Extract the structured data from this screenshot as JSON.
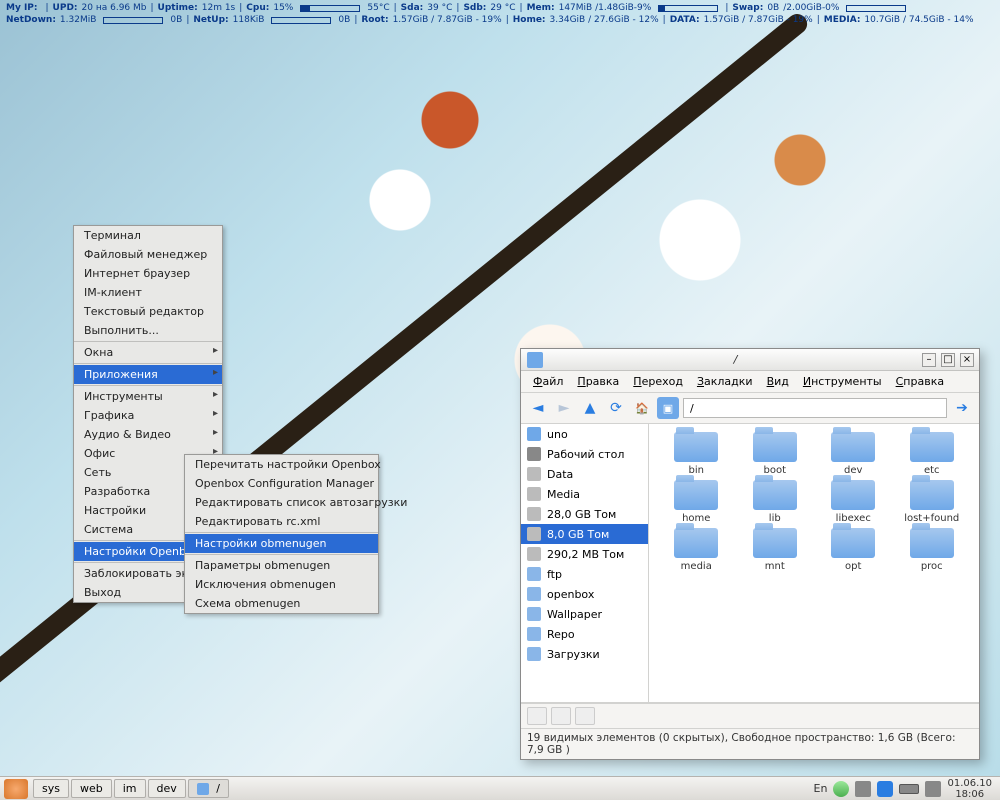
{
  "sysbar": {
    "line1": {
      "ip_label": "My IP:",
      "ip_value": "",
      "upd_label": "UPD:",
      "upd_value": "20 на 6.96 Mb",
      "uptime_label": "Uptime:",
      "uptime_value": "12m 1s",
      "cpu_label": "Cpu:",
      "cpu_value": "15%",
      "cpu_fill": 15,
      "temp1": "55°C",
      "sda_label": "Sda:",
      "sda_value": "39 °C",
      "sdb_label": "Sdb:",
      "sdb_value": "29 °C",
      "mem_label": "Mem:",
      "mem_value": "147MiB /1.48GiB-9%",
      "mem_fill": 9,
      "swap_label": "Swap:",
      "swap_value": "0B",
      "swap_disk": "/2.00GiB-0%",
      "swap_fill": 0
    },
    "line2": {
      "ndown_label": "NetDown:",
      "ndown_value": "1.32MiB",
      "ndown_rate": "0B",
      "nup_label": "NetUp:",
      "nup_value": "118KiB",
      "nup_rate": "0B",
      "root_label": "Root:",
      "root_value": "1.57GiB / 7.87GiB - 19%",
      "home_label": "Home:",
      "home_value": "3.34GiB / 27.6GiB - 12%",
      "data_label": "DATA:",
      "data_value": "1.57GiB / 7.87GiB - 19%",
      "media_label": "MEDIA:",
      "media_value": "10.7GiB / 74.5GiB - 14%"
    }
  },
  "rootmenu": {
    "items": [
      {
        "label": "Терминал"
      },
      {
        "label": "Файловый менеджер"
      },
      {
        "label": "Интернет браузер"
      },
      {
        "label": "IM-клиент"
      },
      {
        "label": "Текстовый редактор"
      },
      {
        "label": "Выполнить..."
      }
    ],
    "windows": {
      "label": "Окна",
      "arrow": true
    },
    "apps": {
      "label": "Приложения",
      "arrow": true,
      "hl": true
    },
    "cats": [
      {
        "label": "Инструменты",
        "arrow": true
      },
      {
        "label": "Графика",
        "arrow": true
      },
      {
        "label": "Аудио & Видео",
        "arrow": true
      },
      {
        "label": "Офис",
        "arrow": true
      },
      {
        "label": "Сеть",
        "arrow": true
      },
      {
        "label": "Разработка",
        "arrow": true
      },
      {
        "label": "Настройки",
        "arrow": true
      },
      {
        "label": "Система",
        "arrow": true
      }
    ],
    "obsettings": {
      "label": "Настройки Openbox",
      "arrow": true,
      "hl": true
    },
    "tail": [
      {
        "label": "Заблокировать экран",
        "arrow": true
      },
      {
        "label": "Выход",
        "arrow": true
      }
    ]
  },
  "submenu": {
    "items": [
      {
        "label": "Перечитать настройки Openbox"
      },
      {
        "label": "Openbox Configuration Manager"
      },
      {
        "label": "Редактировать список автозагрузки"
      },
      {
        "label": "Редактировать rc.xml"
      }
    ],
    "hl": {
      "label": "Настройки  obmenugen"
    },
    "items2": [
      {
        "label": "Параметры obmenugen"
      },
      {
        "label": "Исключения obmenugen"
      },
      {
        "label": "Схема obmenugen"
      }
    ]
  },
  "fm": {
    "title": "/",
    "menu": [
      "Файл",
      "Правка",
      "Переход",
      "Закладки",
      "Вид",
      "Инструменты",
      "Справка"
    ],
    "path": "/",
    "sidebar": [
      {
        "label": "uno",
        "icon": "sic-home"
      },
      {
        "label": "Рабочий стол",
        "icon": "sic-desk"
      },
      {
        "label": "Data",
        "icon": "sic-disk"
      },
      {
        "label": "Media",
        "icon": "sic-disk"
      },
      {
        "label": "28,0 GB Том",
        "icon": "sic-disk"
      },
      {
        "label": "8,0 GB Том",
        "icon": "sic-disk",
        "sel": true
      },
      {
        "label": "290,2 MB Том",
        "icon": "sic-disk"
      },
      {
        "label": "ftp",
        "icon": "sic-folder"
      },
      {
        "label": "openbox",
        "icon": "sic-folder"
      },
      {
        "label": "Wallpaper",
        "icon": "sic-folder"
      },
      {
        "label": "Repo",
        "icon": "sic-folder"
      },
      {
        "label": "Загрузки",
        "icon": "sic-folder"
      }
    ],
    "folders": [
      "bin",
      "boot",
      "dev",
      "etc",
      "home",
      "lib",
      "libexec",
      "lost+found",
      "media",
      "mnt",
      "opt",
      "proc"
    ],
    "status": "19 видимых элементов (0 скрытых), Свободное пространство: 1,6 GB (Всего: 7,9 GB )"
  },
  "taskbar": {
    "buttons": [
      "sys",
      "web",
      "im",
      "dev"
    ],
    "window": "/",
    "lang": "En",
    "clock": {
      "date": "01.06.10",
      "time": "18:06"
    }
  }
}
